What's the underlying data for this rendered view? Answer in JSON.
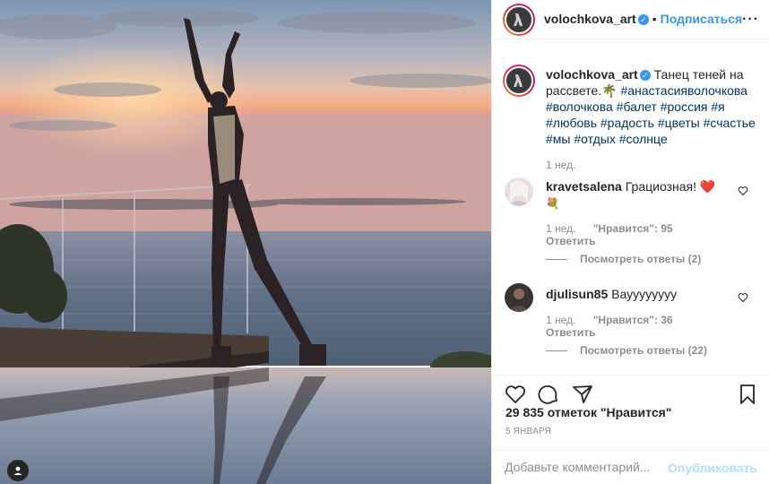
{
  "post": {
    "username": "volochkova_art",
    "separator": "•",
    "follow_label": "Подписаться",
    "verified_symbol": "✓",
    "more_label": "···"
  },
  "caption": {
    "username": "volochkova_art",
    "text": "Танец теней на рассвете.",
    "emoji": "🌴",
    "hashtags": [
      "#анастасияволочкова",
      "#волочкова",
      "#балет",
      "#россия",
      "#я",
      "#любовь",
      "#радость",
      "#цветы",
      "#счастье",
      "#мы",
      "#отдых",
      "#солнце"
    ],
    "time": "1 нед."
  },
  "comments": [
    {
      "username": "kravetsalena",
      "text": "Грациозная! ",
      "emoji": "❤️",
      "emoji2": "💐",
      "time": "1 нед.",
      "likes_label": "\"Нравится\": 95",
      "reply_label": "Ответить",
      "view_replies": "Посмотреть ответы (2)"
    },
    {
      "username": "djulisun85",
      "text": "Вауууууууу",
      "time": "1 нед.",
      "likes_label": "\"Нравится\": 36",
      "reply_label": "Ответить",
      "view_replies": "Посмотреть ответы (22)"
    }
  ],
  "likes": "29 835 отметок \"Нравится\"",
  "date": "5 ЯНВАРЯ",
  "comment_input": {
    "placeholder": "Добавьте комментарий...",
    "publish_label": "Опубликовать"
  },
  "colors": {
    "accent": "#3897f0",
    "link": "#003569",
    "muted": "#8e8e8e",
    "sky_top": "#6f8ba8",
    "sky_horizon": "#f2a98a",
    "sea": "#5d6f84"
  },
  "icons": [
    "verified-icon",
    "more-icon",
    "heart-icon",
    "comment-icon",
    "share-icon",
    "bookmark-icon",
    "user-tag-icon"
  ]
}
